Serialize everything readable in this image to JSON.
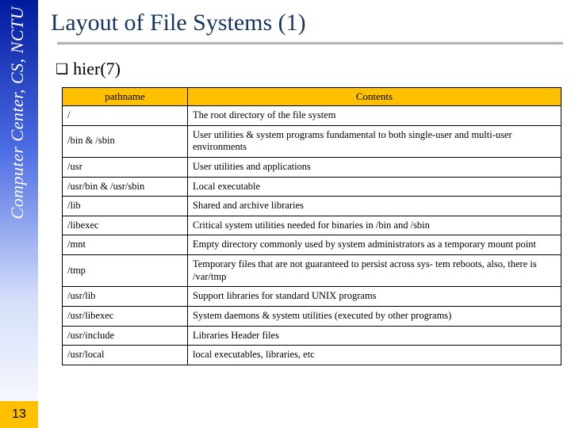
{
  "sidebar": {
    "org_text": "Computer Center, CS, NCTU"
  },
  "page_number": "13",
  "title": "Layout of File Systems (1)",
  "bullet": {
    "marker": "❑",
    "text": "hier(7)"
  },
  "table": {
    "headers": {
      "pathname": "pathname",
      "contents": "Contents"
    },
    "rows": [
      {
        "path": "/",
        "desc": "The root directory of the file system"
      },
      {
        "path": "/bin & /sbin",
        "desc": "User utilities & system programs fundamental to both single-user and multi-user environments"
      },
      {
        "path": "/usr",
        "desc": "User utilities and applications"
      },
      {
        "path": "/usr/bin & /usr/sbin",
        "desc": "Local executable"
      },
      {
        "path": "/lib",
        "desc": "Shared and archive libraries"
      },
      {
        "path": "/libexec",
        "desc": "Critical system utilities needed for binaries in /bin and /sbin"
      },
      {
        "path": "/mnt",
        "desc": "Empty directory commonly used by system administrators as a temporary mount point"
      },
      {
        "path": "/tmp",
        "desc": "Temporary files that are not guaranteed to persist across sys- tem reboots, also, there is /var/tmp"
      },
      {
        "path": "/usr/lib",
        "desc": "Support libraries for standard UNIX programs"
      },
      {
        "path": "/usr/libexec",
        "desc": "System daemons & system utilities (executed by other programs)"
      },
      {
        "path": "/usr/include",
        "desc": "Libraries Header files"
      },
      {
        "path": "/usr/local",
        "desc": "local executables, libraries, etc"
      }
    ]
  }
}
